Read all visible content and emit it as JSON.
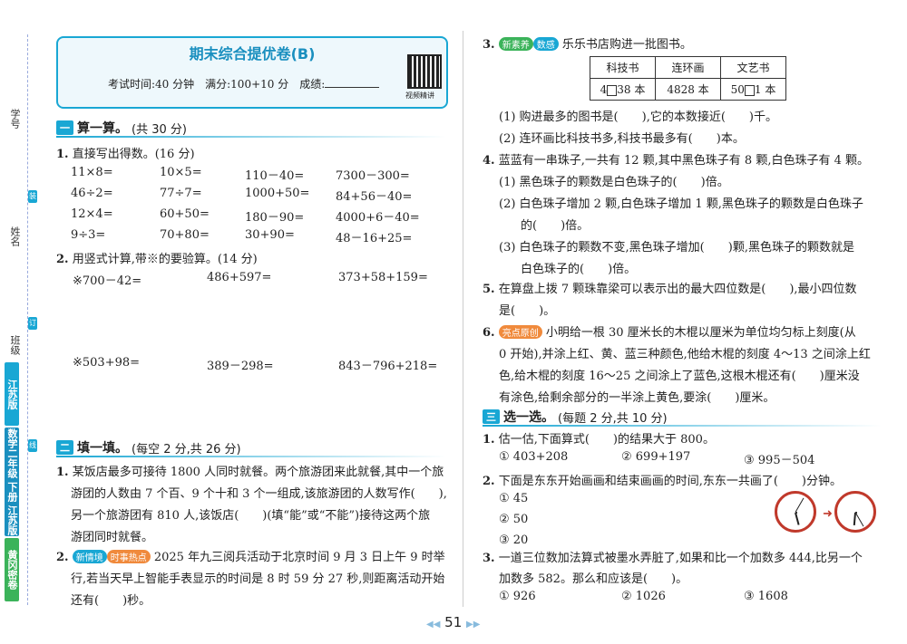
{
  "margin": {
    "xuehao": "学号",
    "xingming": "姓名",
    "banji": "班级",
    "bar1": "江苏版",
    "bar2": "数学二年级 下册 江苏版",
    "bar3": "黄冈密卷",
    "cut1": "装",
    "cut2": "订",
    "cut3": "线"
  },
  "header": {
    "title": "期末综合提优卷(B)",
    "info": "考试时间:40 分钟　满分:100+10 分　成绩:",
    "qr_label": "视频精讲"
  },
  "s1": {
    "num": "一",
    "title": "算一算。",
    "note": "(共 30 分)"
  },
  "q1": {
    "label": "1.",
    "text": "直接写出得数。(16 分)",
    "rows": [
      [
        "11×8=",
        "10×5=",
        "110－40=",
        "7300－300="
      ],
      [
        "46÷2=",
        "77÷7=",
        "1000+50=",
        "84+56－40="
      ],
      [
        "12×4=",
        "60+50=",
        "180－90=",
        "4000+6－40="
      ],
      [
        "9÷3=",
        "70+80=",
        "30+90=",
        "48－16+25="
      ]
    ]
  },
  "q2": {
    "label": "2.",
    "text": "用竖式计算,带※的要验算。(14 分)",
    "row1": [
      "※700－42=",
      "486+597=",
      "373+58+159="
    ],
    "row2": [
      "※503+98=",
      "389－298=",
      "843－796+218="
    ]
  },
  "s2": {
    "num": "二",
    "title": "填一填。",
    "note": "(每空 2 分,共 26 分)"
  },
  "f1": {
    "label": "1.",
    "lines": [
      "某饭店最多可接待 1800 人同时就餐。两个旅游团来此就餐,其中一个旅",
      "游团的人数由 7 个百、9 个十和 3 个一组成,该旅游团的人数写作(　　),",
      "另一个旅游团有 810 人,该饭店(　　)(填“能”或“不能”)接待这两个旅",
      "游团同时就餐。"
    ]
  },
  "f2": {
    "label": "2.",
    "tag": "新情境",
    "tag2": "时事热点",
    "lines": [
      "2025 年九三阅兵活动于北京时间 9 月 3 日上午 9 时举",
      "行,若当天早上智能手表显示的时间是 8 时 59 分 27 秒,则距离活动开始",
      "还有(　　)秒。"
    ]
  },
  "r3": {
    "label": "3.",
    "tag": "新素养",
    "tag2": "数感",
    "text": "乐乐书店购进一批图书。",
    "headers": [
      "科技书",
      "连环画",
      "文艺书"
    ],
    "v1a": "4",
    "v1b": "38 本",
    "v2": "4828 本",
    "v3a": "50",
    "v3b": "1 本",
    "s1": "(1) 购进最多的图书是(　　),它的本数接近(　　)千。",
    "s2": "(2) 连环画比科技书多,科技书最多有(　　)本。"
  },
  "r4": {
    "label": "4.",
    "text": "蓝蓝有一串珠子,一共有 12 颗,其中黑色珠子有 8 颗,白色珠子有 4 颗。",
    "s1": "(1) 黑色珠子的颗数是白色珠子的(　　)倍。",
    "s2a": "(2) 白色珠子增加 2 颗,白色珠子增加 1 颗,黑色珠子的颗数是白色珠子",
    "s2b": "的(　　)倍。",
    "s3a": "(3) 白色珠子的颗数不变,黑色珠子增加(　　)颗,黑色珠子的颗数就是",
    "s3b": "白色珠子的(　　)倍。"
  },
  "r5": {
    "label": "5.",
    "a": "在算盘上拨 7 颗珠靠梁可以表示出的最大四位数是(　　),最小四位数",
    "b": "是(　　)。"
  },
  "r6": {
    "label": "6.",
    "tag": "亮点原创",
    "lines": [
      "小明给一根 30 厘米长的木棍以厘米为单位均匀标上刻度(从",
      "0 开始),并涂上红、黄、蓝三种颜色,他给木棍的刻度 4～13 之间涂上红",
      "色,给木棍的刻度 16～25 之间涂上了蓝色,这根木棍还有(　　)厘米没",
      "有涂色,给剩余部分的一半涂上黄色,要涂(　　)厘米。"
    ]
  },
  "s3": {
    "num": "三",
    "title": "选一选。",
    "note": "(每题 2 分,共 10 分)"
  },
  "c1": {
    "label": "1.",
    "text": "估一估,下面算式(　　)的结果大于 800。",
    "opts": [
      "① 403+208",
      "② 699+197",
      "③ 995－504"
    ]
  },
  "c2": {
    "label": "2.",
    "text": "下面是东东开始画画和结束画画的时间,东东一共画了(　　)分钟。",
    "opts": [
      "① 45",
      "② 50",
      "③ 20"
    ]
  },
  "c3": {
    "label": "3.",
    "a": "一道三位数加法算式被墨水弄脏了,如果和比一个加数多 444,比另一个",
    "b": "加数多 582。那么和应该是(　　)。",
    "opts": [
      "① 926",
      "② 1026",
      "③ 1608"
    ]
  },
  "page": {
    "number": "51"
  }
}
